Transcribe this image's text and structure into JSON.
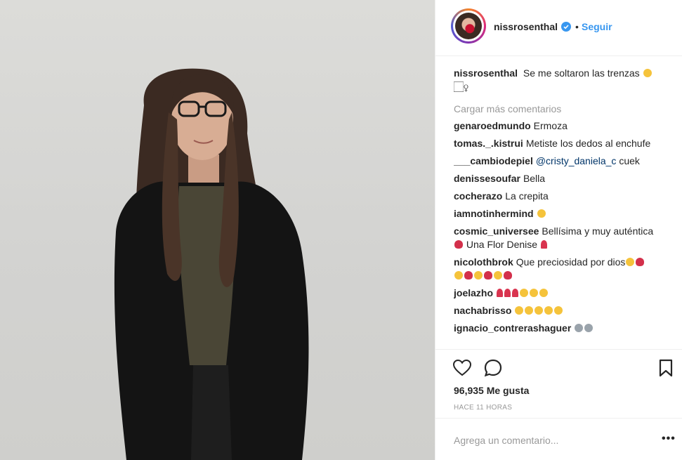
{
  "post": {
    "username": "nissrosenthal",
    "follow_label": "Seguir",
    "separator": "•"
  },
  "caption": {
    "username": "nissrosenthal",
    "text": "Se me soltaron las trenzas",
    "line2": "🏻‍♀"
  },
  "load_more": "Cargar más comentarios",
  "comments": [
    {
      "user": "genaroedmundo",
      "text": "Ermoza"
    },
    {
      "user": "tomas._.kistrui",
      "text": "Metiste los dedos al enchufe"
    },
    {
      "user": "___cambiodepiel",
      "mention": "@cristy_daniela_c",
      "text": "cuek"
    },
    {
      "user": "denissesoufar",
      "text": "Bella"
    },
    {
      "user": "cocherazo",
      "text": "La crepita"
    },
    {
      "user": "iamnotinhermind",
      "text": ""
    },
    {
      "user": "cosmic_universee",
      "text": "Bellísima y muy auténtica",
      "text2": "Una Flor Denise"
    },
    {
      "user": "nicolothbrok",
      "text": "Que preciosidad por dios"
    },
    {
      "user": "joelazho",
      "text": ""
    },
    {
      "user": "nachabrisso",
      "text": ""
    },
    {
      "user": "ignacio_contrerashaguer",
      "text": ""
    }
  ],
  "likes": "96,935 Me gusta",
  "timestamp": "HACE 11 HORAS",
  "add_comment": {
    "placeholder": "Agrega un comentario..."
  },
  "more_label": "•••",
  "icons": {
    "like": "heart-outline-icon",
    "comment": "speech-bubble-icon",
    "save": "bookmark-icon",
    "verified": "verified-badge-icon"
  },
  "colors": {
    "link": "#3897f0",
    "text": "#262626",
    "muted": "#999999",
    "border": "#efefef",
    "verified": "#3897f0"
  }
}
